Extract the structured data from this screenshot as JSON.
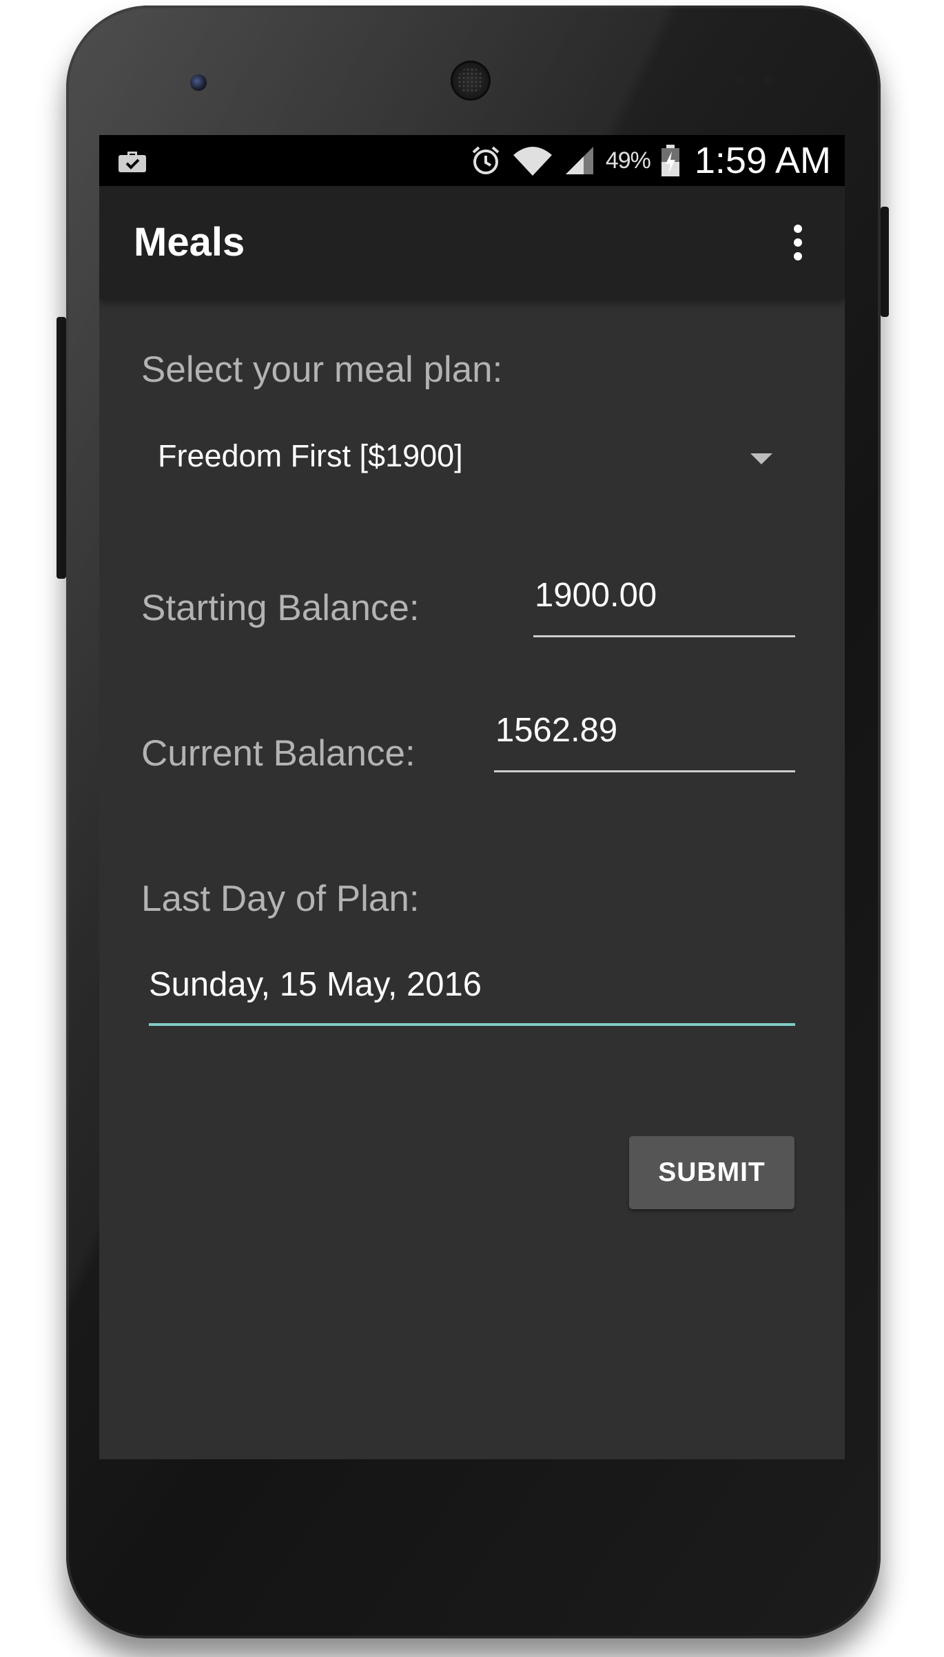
{
  "status_bar": {
    "left_icon": "work-briefcase-check-icon",
    "icons": [
      "alarm-clock-icon",
      "wifi-icon",
      "cell-signal-icon",
      "battery-charging-icon"
    ],
    "battery_percent": "49%",
    "time": "1:59 AM"
  },
  "app_bar": {
    "title": "Meals",
    "overflow_icon": "more-vert-icon"
  },
  "form": {
    "meal_plan_label": "Select your meal plan:",
    "meal_plan_selected": "Freedom First [$1900]",
    "starting_balance_label": "Starting Balance:",
    "starting_balance_value": "1900.00",
    "current_balance_label": "Current Balance:",
    "current_balance_value": "1562.89",
    "last_day_label": "Last Day of Plan:",
    "last_day_value": "Sunday, 15 May, 2016",
    "submit_label": "SUBMIT"
  },
  "colors": {
    "background": "#303030",
    "app_bar": "#212121",
    "accent_underline": "#80cbc4",
    "button": "#555555"
  }
}
